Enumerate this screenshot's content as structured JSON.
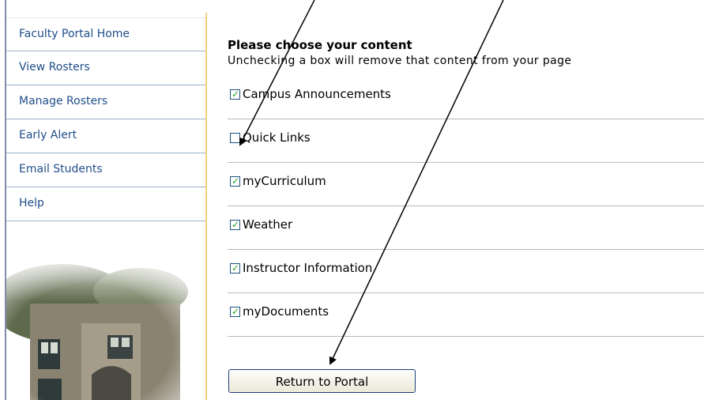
{
  "sidebar": {
    "items": [
      {
        "label": "Faculty Portal Home"
      },
      {
        "label": "View Rosters"
      },
      {
        "label": "Manage Rosters"
      },
      {
        "label": "Early Alert"
      },
      {
        "label": "Email Students"
      },
      {
        "label": "Help"
      }
    ]
  },
  "content": {
    "heading": "Please choose your content",
    "subheading": "Unchecking a box will remove that content from your page",
    "options": [
      {
        "label": "Campus Announcements",
        "checked": true
      },
      {
        "label": "Quick Links",
        "checked": false
      },
      {
        "label": "myCurriculum",
        "checked": true
      },
      {
        "label": "Weather",
        "checked": true
      },
      {
        "label": "Instructor Information",
        "checked": true
      },
      {
        "label": "myDocuments",
        "checked": true
      }
    ],
    "return_button": "Return to Portal"
  },
  "colors": {
    "nav_text": "#1f4e8a",
    "check_green": "#21a121",
    "sidebar_divider": "#f3cf7a"
  }
}
